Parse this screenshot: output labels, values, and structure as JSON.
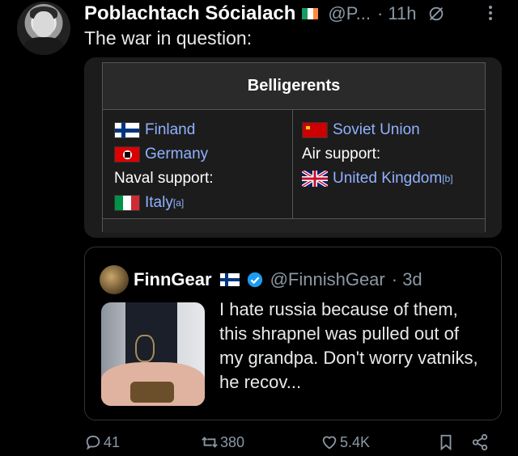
{
  "tweet": {
    "author_name": "Poblachtach Sócialach",
    "author_handle": "@P...",
    "time": "· 11h",
    "text": "The war in question:"
  },
  "wiki_table": {
    "heading": "Belligerents",
    "left": {
      "finland": "Finland",
      "germany": "Germany",
      "naval_support": "Naval support:",
      "italy": "Italy",
      "italy_note": "[a]"
    },
    "right": {
      "soviet": "Soviet Union",
      "air_support": "Air support:",
      "uk": "United Kingdom",
      "uk_note": "[b]"
    }
  },
  "quote": {
    "name": "FinnGear",
    "handle": "@FinnishGear",
    "time": "· 3d",
    "text": "I hate russia because of them, this shrapnel was pulled out of my grandpa. Don't worry vatniks, he recov..."
  },
  "actions": {
    "replies": "41",
    "retweets": "380",
    "likes": "5.4K"
  },
  "colors": {
    "background": "#000000",
    "link": "#8fb1ff",
    "muted": "#8b98a5",
    "verified": "#1d9bf0"
  },
  "icons": [
    "muted-icon",
    "more-icon",
    "verified-icon",
    "reply-icon",
    "retweet-icon",
    "like-icon",
    "bookmark-icon",
    "share-icon"
  ]
}
